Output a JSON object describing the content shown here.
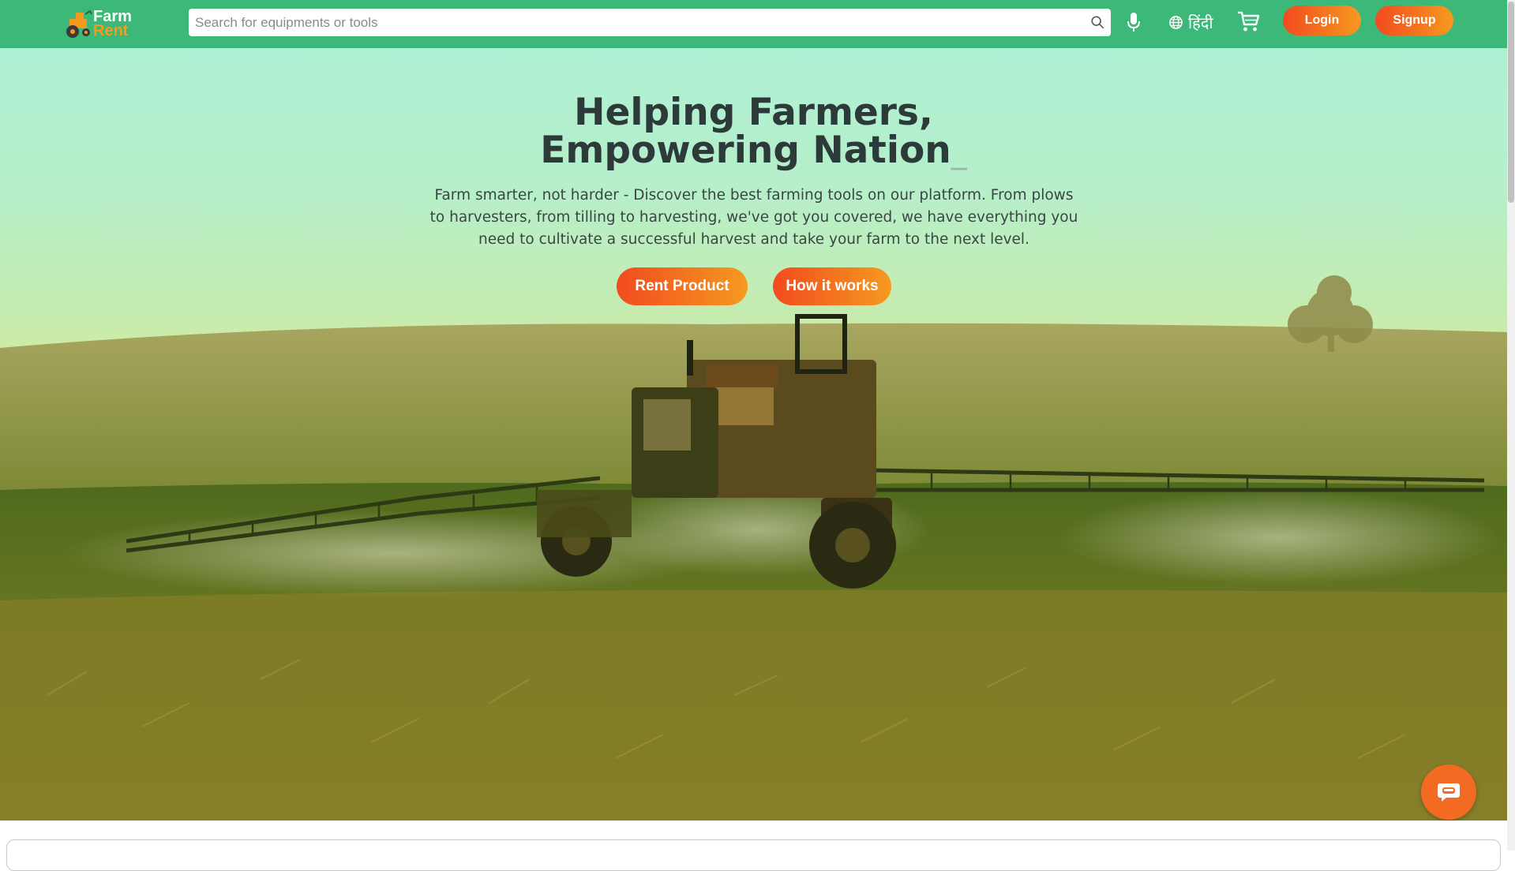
{
  "brand": {
    "line1": "Farm",
    "line2": "Rent"
  },
  "search": {
    "placeholder": "Search for equipments or tools",
    "value": ""
  },
  "header": {
    "language_label": "हिंदी",
    "login_label": "Login",
    "signup_label": "Signup"
  },
  "hero": {
    "title_line1": "Helping Farmers,",
    "title_line2": "Empowering Nation",
    "cursor": "_",
    "description": "Farm smarter, not harder - Discover the best farming tools on our platform. From plows to harvesters, from tilling to harvesting, we've got you covered, we have everything you need to cultivate a successful harvest and take your farm to the next level.",
    "rent_button": "Rent Product",
    "how_button": "How it works"
  },
  "icons": {
    "logo": "tractor-icon",
    "search": "search-icon",
    "mic": "microphone-icon",
    "language": "globe-icon",
    "cart": "cart-icon",
    "chat": "chat-icon"
  },
  "colors": {
    "nav_bg": "#3cb878",
    "accent_orange": "#f47a1f",
    "brand_orange": "#f39a1f",
    "title_text": "#2c3a3a"
  }
}
